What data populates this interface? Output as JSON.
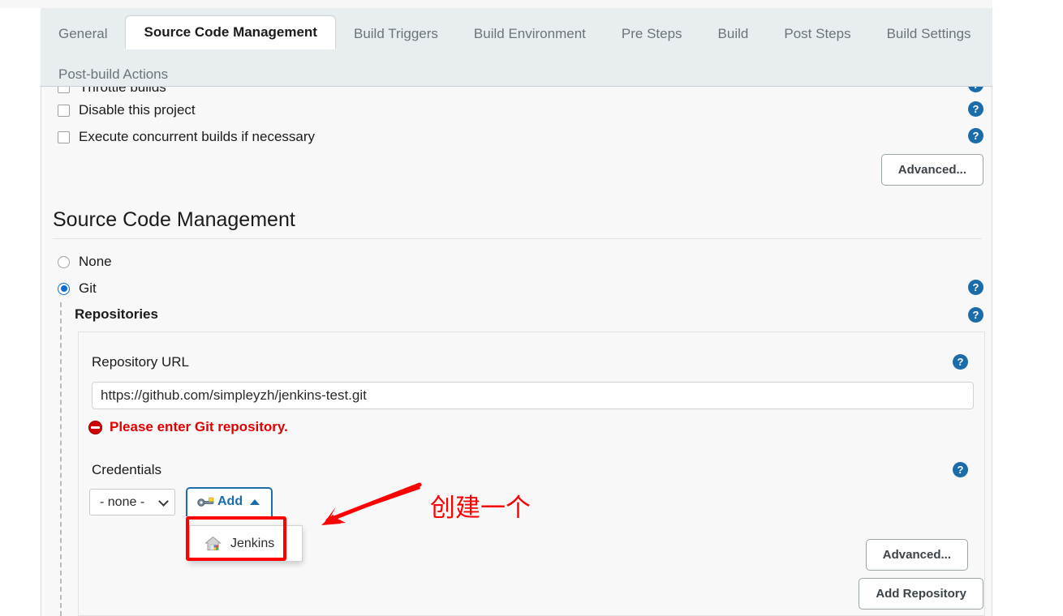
{
  "tabs": {
    "row1": [
      {
        "label": "General",
        "active": false
      },
      {
        "label": "Source Code Management",
        "active": true
      },
      {
        "label": "Build Triggers",
        "active": false
      },
      {
        "label": "Build Environment",
        "active": false
      },
      {
        "label": "Pre Steps",
        "active": false
      },
      {
        "label": "Build",
        "active": false
      },
      {
        "label": "Post Steps",
        "active": false
      },
      {
        "label": "Build Settings",
        "active": false
      }
    ],
    "row2": [
      {
        "label": "Post-build Actions",
        "active": false
      }
    ]
  },
  "general": {
    "cutoff_checkbox_label": "Throttle builds",
    "checkboxes": [
      {
        "label": "Disable this project",
        "checked": false
      },
      {
        "label": "Execute concurrent builds if necessary",
        "checked": false
      }
    ],
    "advanced_label": "Advanced..."
  },
  "scm": {
    "title": "Source Code Management",
    "options": [
      {
        "label": "None",
        "selected": false
      },
      {
        "label": "Git",
        "selected": true
      }
    ],
    "repositories_label": "Repositories",
    "repository_url_label": "Repository URL",
    "repository_url_value": "https://github.com/simpleyzh/jenkins-test.git",
    "repository_url_placeholder": "",
    "error_message": "Please enter Git repository.",
    "credentials_label": "Credentials",
    "credentials_selected": "- none -",
    "credentials_options": [
      "- none -"
    ],
    "add_button_label": "Add",
    "add_menu_items": [
      {
        "label": "Jenkins",
        "icon": "jenkins-house-icon"
      }
    ],
    "advanced_label": "Advanced...",
    "add_repository_label": "Add Repository"
  },
  "icons": {
    "help": "?",
    "key": "key-icon",
    "caret_up": "caret-up-icon",
    "error": "error-circle-icon",
    "chevron_down": "chevron-down-icon"
  },
  "annotation": {
    "text": "创建一个",
    "arrow": "red-arrow",
    "highlight": "red-highlight-box"
  },
  "colors": {
    "accent_blue": "#1b6ca8",
    "radio_blue": "#0b6cd6",
    "error_red": "#e00000",
    "annotation_red": "#fe0000",
    "tabbar_bg": "#e8eef0",
    "panel_bg": "#f8f8f8"
  }
}
